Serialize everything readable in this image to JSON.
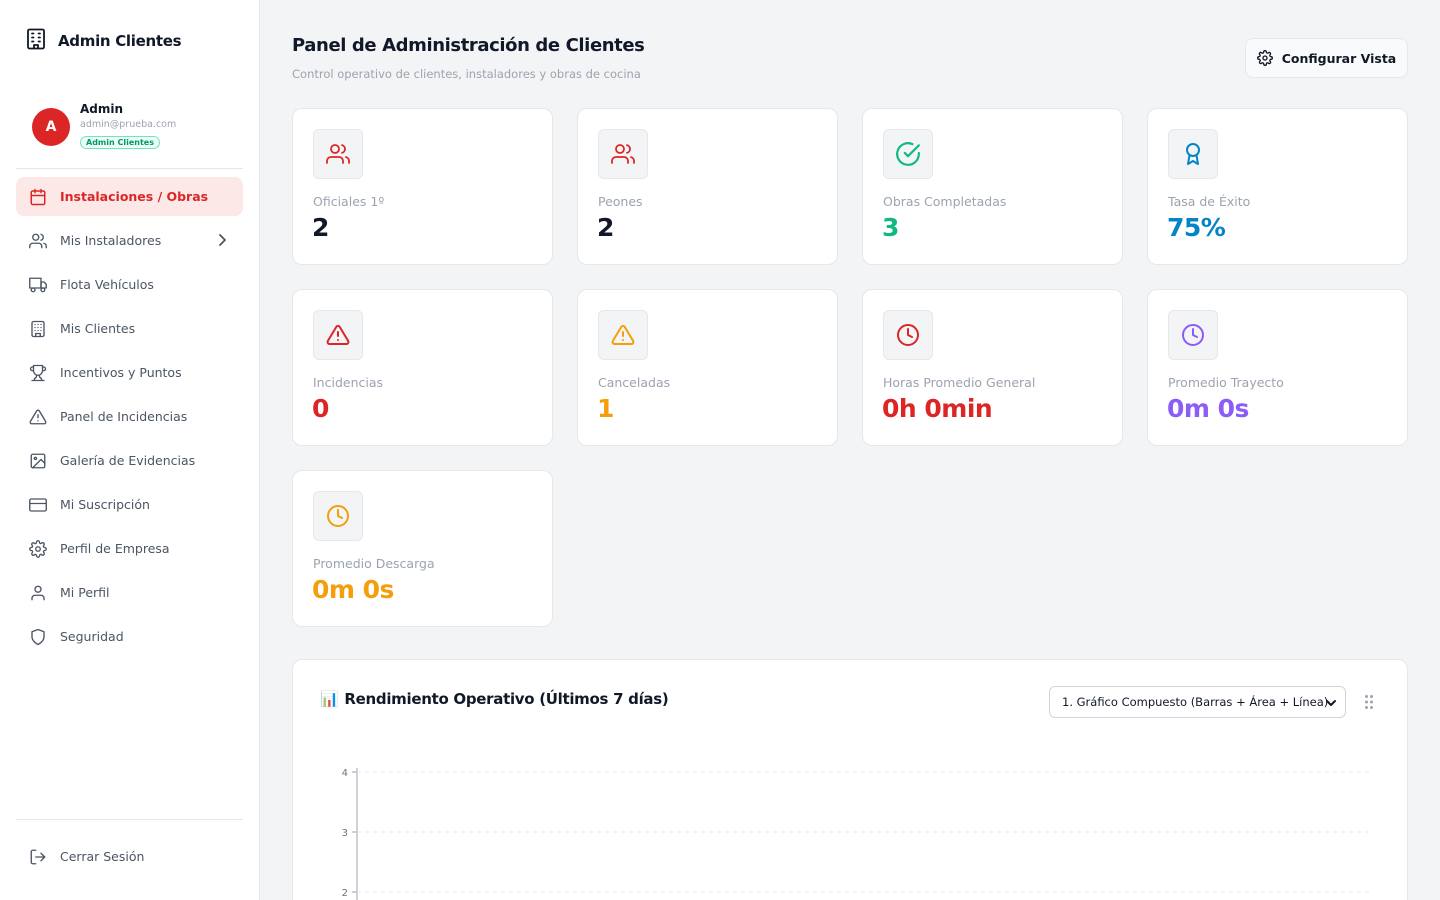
{
  "sidebar": {
    "brand_title": "Admin Clientes",
    "user": {
      "initial": "A",
      "name": "Admin",
      "email": "admin@prueba.com",
      "role": "Admin Clientes"
    },
    "items": [
      {
        "label": "Instalaciones / Obras",
        "icon": "calendar-icon",
        "active": true
      },
      {
        "label": "Mis Instaladores",
        "icon": "users-icon"
      },
      {
        "label": "Flota Vehículos",
        "icon": "truck-icon"
      },
      {
        "label": "Mis Clientes",
        "icon": "building-icon"
      },
      {
        "label": "Incentivos y Puntos",
        "icon": "trophy-icon"
      },
      {
        "label": "Panel de Incidencias",
        "icon": "alert-triangle-icon"
      },
      {
        "label": "Galería de Evidencias",
        "icon": "image-icon"
      },
      {
        "label": "Mi Suscripción",
        "icon": "credit-card-icon"
      },
      {
        "label": "Perfil de Empresa",
        "icon": "settings-icon"
      },
      {
        "label": "Mi Perfil",
        "icon": "user-icon"
      },
      {
        "label": "Seguridad",
        "icon": "shield-icon"
      }
    ],
    "logout_label": "Cerrar Sesión"
  },
  "header": {
    "title": "Panel de Administración de Clientes",
    "subtitle": "Control operativo de clientes, instaladores y obras de cocina",
    "config_button": "Configurar Vista"
  },
  "stats": [
    {
      "label": "Oficiales 1º",
      "value": "2",
      "color": "#111827",
      "icon": "users-icon",
      "icon_color": "#dc2626"
    },
    {
      "label": "Peones",
      "value": "2",
      "color": "#111827",
      "icon": "users-icon",
      "icon_color": "#dc2626"
    },
    {
      "label": "Obras Completadas",
      "value": "3",
      "color": "#10b981",
      "icon": "check-circle-icon",
      "icon_color": "#10b981"
    },
    {
      "label": "Tasa de Éxito",
      "value": "75%",
      "color": "#0284c7",
      "icon": "award-icon",
      "icon_color": "#0284c7"
    },
    {
      "label": "Incidencias",
      "value": "0",
      "color": "#dc2626",
      "icon": "alert-triangle-icon",
      "icon_color": "#dc2626"
    },
    {
      "label": "Canceladas",
      "value": "1",
      "color": "#f59e0b",
      "icon": "alert-triangle-icon",
      "icon_color": "#f59e0b"
    },
    {
      "label": "Horas Promedio General",
      "value": "0h 0min",
      "color": "#dc2626",
      "icon": "clock-icon",
      "icon_color": "#dc2626"
    },
    {
      "label": "Promedio Trayecto",
      "value": "0m 0s",
      "color": "#8b5cf6",
      "icon": "clock-icon",
      "icon_color": "#8b5cf6"
    },
    {
      "label": "Promedio Descarga",
      "value": "0m 0s",
      "color": "#f59e0b",
      "icon": "clock-icon",
      "icon_color": "#f59e0b"
    }
  ],
  "chart_panel": {
    "emoji": "📊",
    "title": "Rendimiento Operativo (Últimos 7 días)",
    "select_value": "1. Gráfico Compuesto (Barras + Área + Línea)"
  },
  "chart_data": {
    "type": "bar",
    "title": "Rendimiento Operativo (Últimos 7 días)",
    "y_ticks": [
      4,
      3,
      2
    ],
    "ylim": [
      0,
      4
    ],
    "grid": true,
    "series": []
  }
}
